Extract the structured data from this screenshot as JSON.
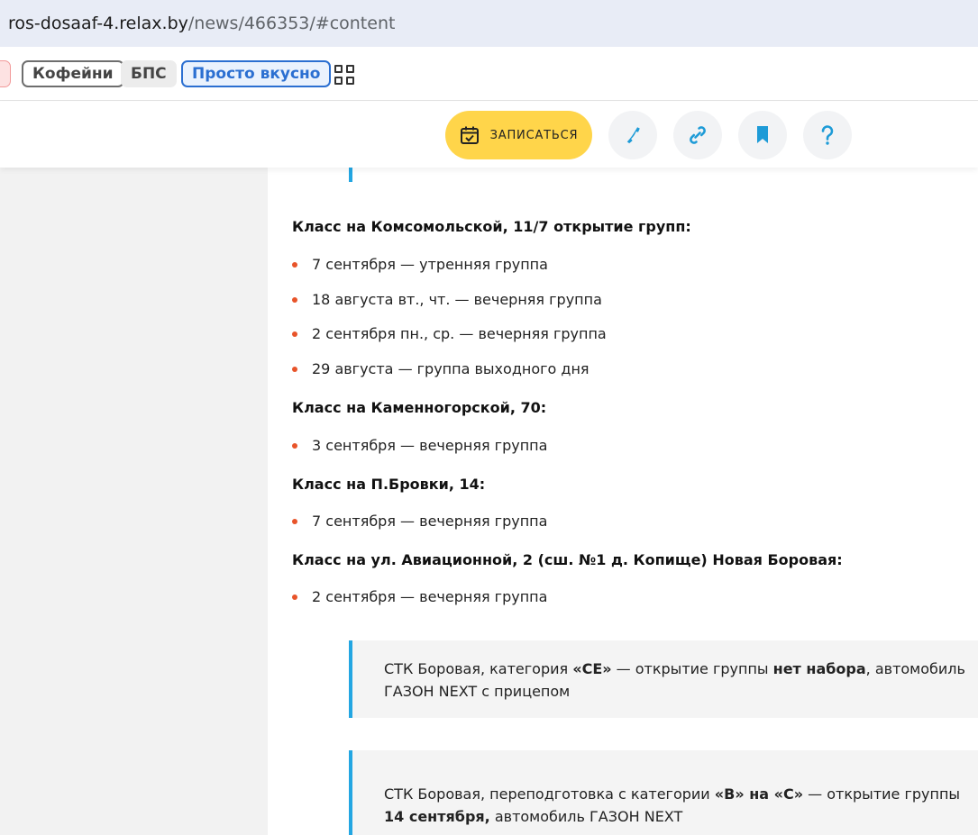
{
  "url": {
    "host": "ros-dosaaf-4.relax.by",
    "path": "/news/466353/#content"
  },
  "categories": [
    {
      "label": "Кофейни",
      "style": "outlined-gray"
    },
    {
      "label": "БПС",
      "style": "filled-gray"
    },
    {
      "label": "Просто вкусно",
      "style": "outlined-blue"
    }
  ],
  "actions": {
    "signup_label": "ЗАПИСАТЬСЯ",
    "icons": [
      "phone-icon",
      "link-icon",
      "bookmark-icon",
      "question-icon"
    ]
  },
  "article": {
    "sections": [
      {
        "heading": "Класс на Комсомольской, 11/7 открытие групп:",
        "items": [
          "7 сентября — утренняя группа",
          "18 августа вт., чт. — вечерняя группа",
          "2 сентября пн., ср. — вечерняя группа",
          "29 августа — группа выходного дня"
        ]
      },
      {
        "heading": "Класс на Каменногорской, 70:",
        "items": [
          "3 сентября — вечерняя группа"
        ]
      },
      {
        "heading": "Класс на П.Бровки, 14:",
        "items": [
          "7 сентября — вечерняя группа"
        ]
      },
      {
        "heading": "Класс на ул. Авиационной, 2 (сш. №1 д. Копище) Новая Боровая:",
        "items": [
          "2 сентября — вечерняя группа"
        ]
      }
    ],
    "notes": [
      {
        "t1": "СТК Боровая, категория ",
        "b1": "«CE»",
        "t2": " — открытие группы ",
        "b2": "нет набора",
        "t3": ", автомобиль ГАЗОН NEXT с прицепом"
      },
      {
        "t1": "СТК Боровая, переподготовка с категории ",
        "b1": "«В» на «С»",
        "t2": " — открытие группы ",
        "b2": "14 сентября,",
        "t3": " автомобиль ГАЗОН NEXT"
      }
    ]
  },
  "colors": {
    "accent": "#23a6e2",
    "bullet": "#e8542a",
    "signup": "#ffd54a",
    "chip_blue": "#2b6fd1"
  }
}
